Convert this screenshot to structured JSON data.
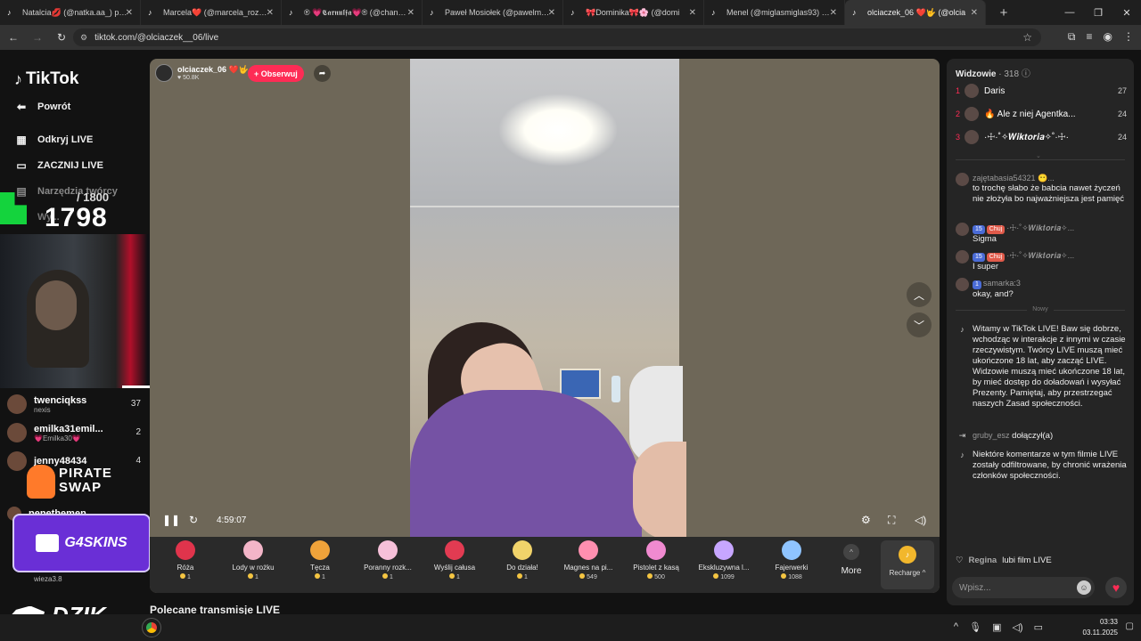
{
  "browser": {
    "tabs": [
      {
        "label": "Natalcia💋 (@natka.aa_) prowa",
        "active": false
      },
      {
        "label": "Marcela❤️ (@marcela_rozum) j",
        "active": false
      },
      {
        "label": "® 💗𝕮𝖆𝖗𝖓𝖚𝖑𝖋𝖆💗® (@chanelka",
        "active": false
      },
      {
        "label": "Paweł Mosiołek (@pawelmosio",
        "active": false
      },
      {
        "label": "🎀Dominika🎀🌸 (@domi",
        "active": false
      },
      {
        "label": "Menel (@miglasmiglas93) prow",
        "active": false
      },
      {
        "label": "olciaczek_06 ❤️🤟 (@olcia",
        "active": true
      }
    ],
    "url": "tiktok.com/@olciaczek__06/live"
  },
  "sidebar": {
    "logo": "TikTok",
    "items": [
      {
        "label": "Powrót",
        "icon": "back-arrow-icon"
      },
      {
        "label": "Odkryj LIVE",
        "icon": "calendar-icon"
      },
      {
        "label": "ZACZNIJ LIVE",
        "icon": "camera-icon"
      },
      {
        "label": "Narzędzia twórcy",
        "icon": "tools-icon"
      }
    ],
    "ghost_label": "Wy...",
    "counter": {
      "small": "/ 1800",
      "big": "1798"
    },
    "viewers": [
      {
        "name": "twenciqkss",
        "sub": "nexis",
        "count": "37"
      },
      {
        "name": "emilka31emil...",
        "sub": "💗Emilka30💗",
        "count": "2"
      },
      {
        "name": "jenny48434",
        "sub": "",
        "count": "4"
      },
      {
        "name": "pepethemen",
        "sub": "",
        "count": ""
      }
    ],
    "pirate": "PIRATE\nSWAP",
    "g4skins": "G4SKINS",
    "wieza": "wieza3.8",
    "dzik": "DZIK"
  },
  "stage": {
    "host_name": "olciaczek_06 ❤️🤟",
    "host_likes": "♥ 50.8K",
    "follow_label": "+ Obserwuj",
    "time": "4:59:07",
    "gifts": [
      {
        "name": "Róża",
        "price": "1",
        "color": "#e0344c"
      },
      {
        "name": "Lody w rożku",
        "price": "1",
        "color": "#f3b5c8"
      },
      {
        "name": "Tęcza",
        "price": "1",
        "color": "#f0a33a"
      },
      {
        "name": "Poranny rozk...",
        "price": "1",
        "color": "#f6c0d9"
      },
      {
        "name": "Wyślij całusa",
        "price": "1",
        "color": "#e23b52"
      },
      {
        "name": "Do działa!",
        "price": "1",
        "color": "#f1d36a"
      },
      {
        "name": "Magnes na pi...",
        "price": "549",
        "color": "#ff8fb0"
      },
      {
        "name": "Pistolet z kasą",
        "price": "500",
        "color": "#f08ad0"
      },
      {
        "name": "Ekskluzywna l...",
        "price": "1099",
        "color": "#c7a6ff"
      },
      {
        "name": "Fajerwerki",
        "price": "1088",
        "color": "#8fc4ff"
      }
    ],
    "more_label": "More",
    "recharge_label": "Recharge ^"
  },
  "recommended_title": "Polecane transmisje LIVE",
  "panel": {
    "title": "Widzowie",
    "viewer_count": "· 318",
    "top": [
      {
        "rank": "1",
        "name": "Daris",
        "score": "27"
      },
      {
        "rank": "2",
        "name": "🔥 Ale z niej Agentka...",
        "score": "24"
      },
      {
        "rank": "3",
        "name": "·☩·˚✧𝑾𝒊𝒌𝒕𝒐𝒓𝒊𝒂✧˚·☩·",
        "score": "24"
      }
    ],
    "messages": [
      {
        "user": "zajętabasia54321 😶...",
        "text": "to trochę słabo że babcia nawet życzeń nie złożyła bo najważniejsza jest pamięć"
      },
      {
        "user": "·☩·˚✧𝑾𝒊𝒌𝒕𝒐𝒓𝒊𝒂✧...",
        "badge1": "15",
        "badge2": "Chuj",
        "text": "Sigma"
      },
      {
        "user": "·☩·˚✧𝑾𝒊𝒌𝒕𝒐𝒓𝒊𝒂✧...",
        "badge1": "15",
        "badge2": "Chuj",
        "text": "I super"
      },
      {
        "user": "samarka:3",
        "badge1": "1",
        "text": "okay, and?"
      }
    ],
    "new_label": "Nowy",
    "system_welcome": "Witamy w TikTok LIVE! Baw się dobrze, wchodząc w interakcje z innymi w czasie rzeczywistym. Twórcy LIVE muszą mieć ukończone 18 lat, aby zacząć LIVE. Widzowie muszą mieć ukończone 18 lat, by mieć dostęp do doładowań i wysyłać Prezenty. Pamiętaj, aby przestrzegać naszych Zasad społeczności.",
    "join_user": "gruby_esz",
    "join_text": "dołączył(a)",
    "filtered_text": "Niektóre komentarze w tym filmie LIVE zostały odfiltrowane, by chronić wrażenia członków społeczności.",
    "likes_user": "Regina",
    "likes_text": "lubi film LIVE",
    "input_placeholder": "Wpisz..."
  },
  "taskbar": {
    "time": "03:33",
    "date": "03.11.2025"
  }
}
